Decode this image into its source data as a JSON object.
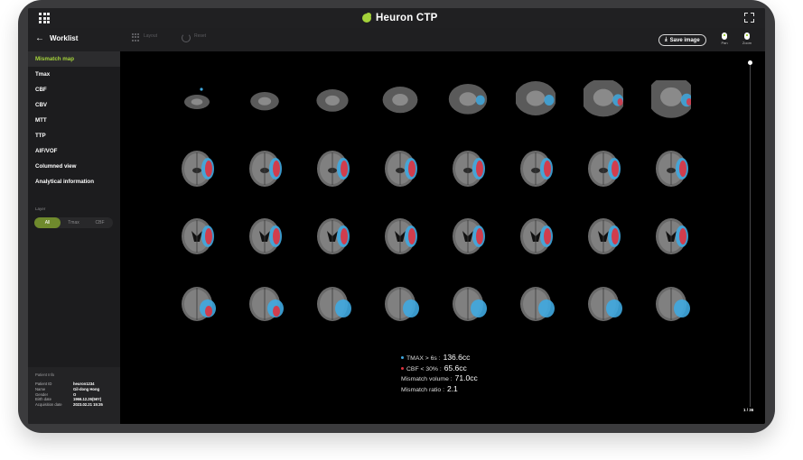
{
  "app": {
    "title": "Heuron CTP"
  },
  "toolbar": {
    "back_label": "Worklist",
    "layout_label": "Layout",
    "reset_label": "Reset",
    "save_label": "Save image",
    "pan_label": "Pan",
    "zoom_label": "Zoom"
  },
  "sidebar": {
    "items": [
      {
        "label": "Mismatch map",
        "active": true
      },
      {
        "label": "Tmax",
        "active": false
      },
      {
        "label": "CBF",
        "active": false
      },
      {
        "label": "CBV",
        "active": false
      },
      {
        "label": "MTT",
        "active": false
      },
      {
        "label": "TTP",
        "active": false
      },
      {
        "label": "AIF/VOF",
        "active": false
      },
      {
        "label": "Columned view",
        "active": false
      },
      {
        "label": "Analytical information",
        "active": false
      }
    ],
    "layer_title": "Layer",
    "layer_options": [
      "All",
      "Tmax",
      "CBF"
    ],
    "layer_selected": "All"
  },
  "patient_info": {
    "title": "Patient Info",
    "rows": [
      {
        "key": "Patient ID",
        "value": "heuron1234"
      },
      {
        "key": "Name",
        "value": "Gil-dong Hong"
      },
      {
        "key": "Gender",
        "value": "O"
      },
      {
        "key": "Birth date",
        "value": "1966.12.26(56Y)"
      },
      {
        "key": "Acquisition date",
        "value": "2023.02.21 15:35"
      }
    ]
  },
  "viewer": {
    "legend": [
      {
        "label": "TMAX > 6s :",
        "value": "136.6cc",
        "color": "#3fa9e0"
      },
      {
        "label": "CBF < 30% :",
        "value": "65.6cc",
        "color": "#e0323e"
      }
    ],
    "mismatch_volume_label": "Mismatch volume :",
    "mismatch_volume": "71.0cc",
    "mismatch_ratio_label": "Mismatch ratio :",
    "mismatch_ratio": "2.1",
    "page": "1 / 36",
    "slice_count": 32
  },
  "colors": {
    "accent": "#a4d23a",
    "tmax": "#3fa9e0",
    "cbf": "#e0323e"
  }
}
